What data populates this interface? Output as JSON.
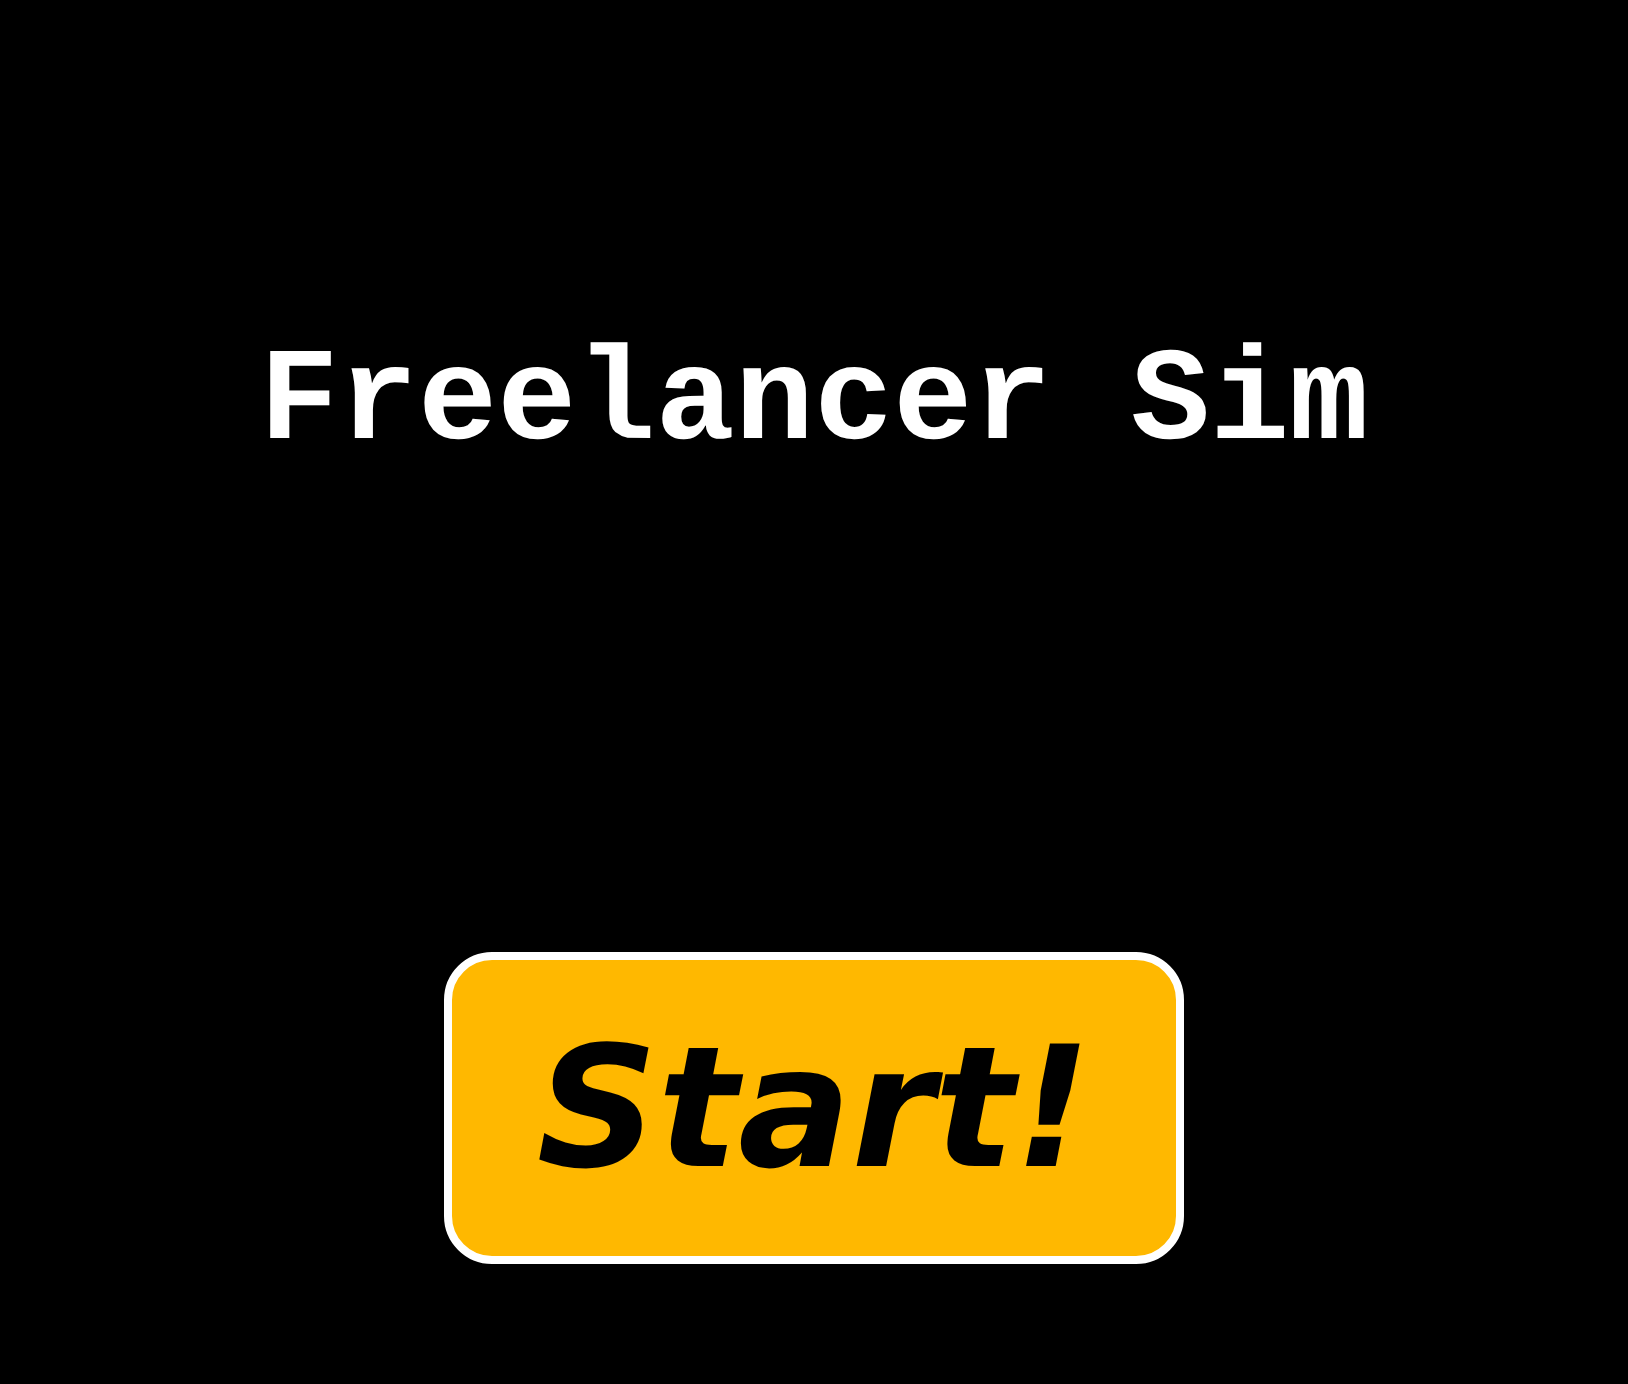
{
  "title": "Freelancer Sim",
  "start_button": {
    "label": "Start!"
  }
}
